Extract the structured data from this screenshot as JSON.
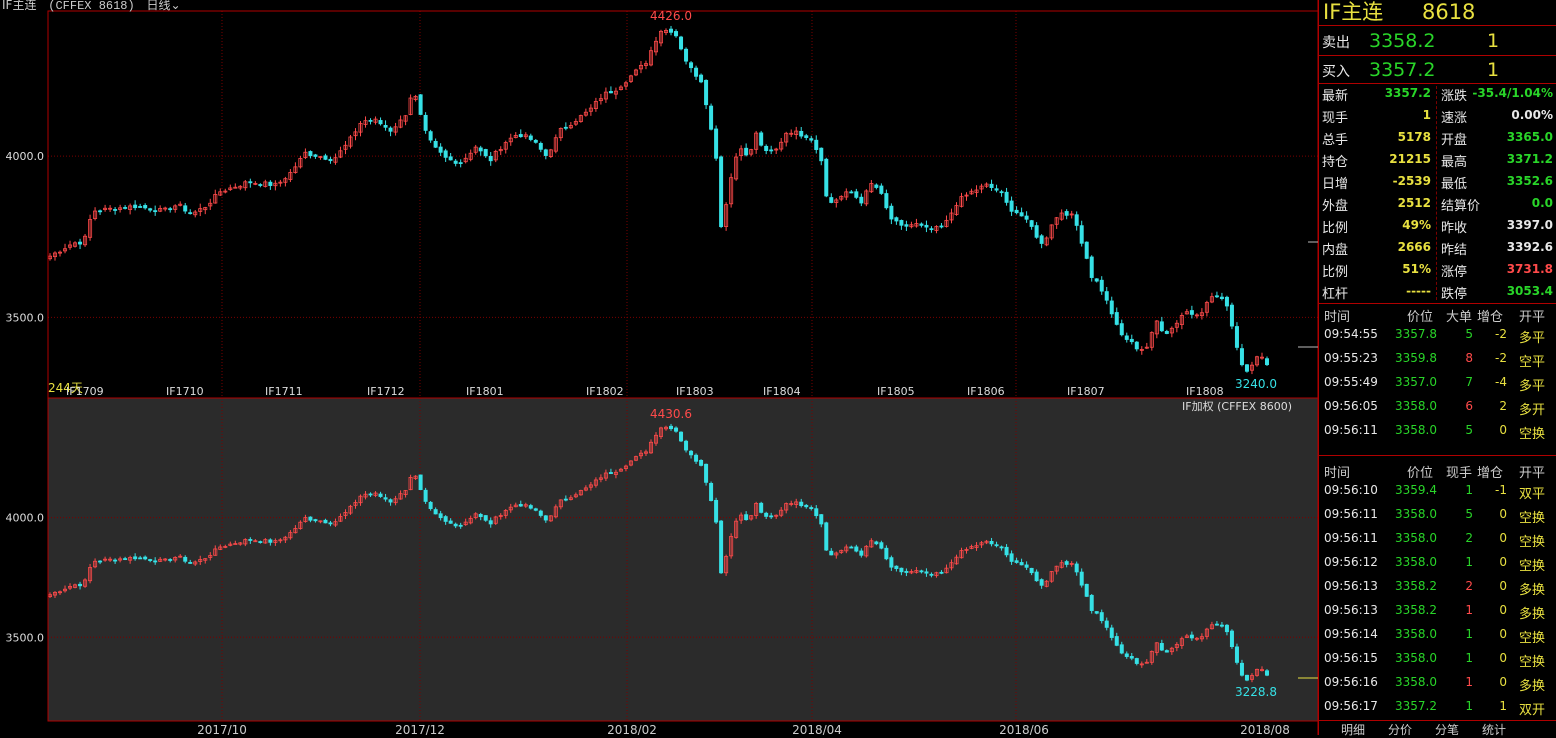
{
  "colors": {
    "up": "#ff4a4a",
    "down": "#36e1e6",
    "grid": "#7a0000",
    "frame": "#b00000",
    "upper_bg": "#000000",
    "lower_bg": "#2b2b2b",
    "yellow": "#e8e040",
    "green": "#29d529",
    "white": "#e8e8e8"
  },
  "header": {
    "instrument": "IF主连",
    "code_text": "(CFFEX 8618)",
    "period": "日线",
    "dropdown_icon": "chevron-down-icon"
  },
  "upper_panel": {
    "ticks": [
      "4000.0",
      "3500.0"
    ],
    "day_count": "244天",
    "high_label": "4426.0",
    "low_label": "3240.0",
    "contract_labels": [
      "IF1709",
      "IF1710",
      "IF1711",
      "IF1712",
      "IF1801",
      "IF1802",
      "IF1803",
      "IF1804",
      "IF1805",
      "IF1806",
      "IF1807",
      "IF1808"
    ]
  },
  "lower_panel": {
    "title": "IF加权 (CFFEX 8600)",
    "ticks": [
      "4000.0",
      "3500.0"
    ],
    "high_label": "4430.6",
    "low_label": "3228.8"
  },
  "x_axis": {
    "labels": [
      "2017/10",
      "2017/12",
      "2018/02",
      "2018/04",
      "2018/06",
      "2018/08"
    ]
  },
  "chart_data": [
    {
      "type": "candlestick",
      "title": "IF主连 (CFFEX 8618) 日线",
      "ylim": [
        3250,
        4450
      ],
      "y_ticks": [
        4000,
        3500
      ],
      "days": 244,
      "x_range": [
        "2017-07",
        "2018-08"
      ],
      "high": 4426.0,
      "low": 3240.0,
      "anchors": [
        [
          0,
          3690
        ],
        [
          8,
          3730
        ],
        [
          12,
          3735
        ],
        [
          15,
          3830
        ],
        [
          30,
          3845
        ],
        [
          40,
          3830
        ],
        [
          45,
          3850
        ],
        [
          50,
          3820
        ],
        [
          55,
          3845
        ],
        [
          60,
          3890
        ],
        [
          70,
          3920
        ],
        [
          80,
          3910
        ],
        [
          85,
          3950
        ],
        [
          90,
          4010
        ],
        [
          100,
          3990
        ],
        [
          105,
          4040
        ],
        [
          110,
          4110
        ],
        [
          115,
          4110
        ],
        [
          120,
          4080
        ],
        [
          125,
          4120
        ],
        [
          128,
          4210
        ],
        [
          132,
          4080
        ],
        [
          135,
          4030
        ],
        [
          140,
          3990
        ],
        [
          145,
          3980
        ],
        [
          150,
          4030
        ],
        [
          155,
          3985
        ],
        [
          160,
          4040
        ],
        [
          165,
          4070
        ],
        [
          170,
          4050
        ],
        [
          175,
          4000
        ],
        [
          180,
          4080
        ],
        [
          185,
          4110
        ],
        [
          190,
          4140
        ],
        [
          195,
          4190
        ],
        [
          200,
          4210
        ],
        [
          205,
          4250
        ],
        [
          210,
          4290
        ],
        [
          215,
          4390
        ],
        [
          220,
          4390
        ],
        [
          225,
          4280
        ],
        [
          230,
          4230
        ],
        [
          232,
          4130
        ],
        [
          235,
          3990
        ],
        [
          236,
          3760
        ],
        [
          238,
          3840
        ],
        [
          240,
          3930
        ],
        [
          243,
          4040
        ],
        [
          246,
          3990
        ],
        [
          249,
          4070
        ],
        [
          252,
          4010
        ],
        [
          256,
          4020
        ],
        [
          260,
          4080
        ],
        [
          264,
          4070
        ],
        [
          268,
          4060
        ],
        [
          272,
          3990
        ],
        [
          274,
          3850
        ],
        [
          278,
          3870
        ],
        [
          282,
          3890
        ],
        [
          286,
          3860
        ],
        [
          290,
          3920
        ],
        [
          293,
          3880
        ],
        [
          296,
          3810
        ],
        [
          300,
          3780
        ],
        [
          305,
          3790
        ],
        [
          310,
          3770
        ],
        [
          315,
          3780
        ],
        [
          320,
          3860
        ],
        [
          325,
          3890
        ],
        [
          330,
          3910
        ],
        [
          335,
          3890
        ],
        [
          338,
          3840
        ],
        [
          342,
          3820
        ],
        [
          346,
          3780
        ],
        [
          350,
          3720
        ],
        [
          353,
          3790
        ],
        [
          357,
          3830
        ],
        [
          361,
          3810
        ],
        [
          365,
          3700
        ],
        [
          367,
          3630
        ],
        [
          370,
          3600
        ],
        [
          374,
          3520
        ],
        [
          377,
          3450
        ],
        [
          380,
          3430
        ],
        [
          384,
          3400
        ],
        [
          387,
          3410
        ],
        [
          390,
          3490
        ],
        [
          393,
          3450
        ],
        [
          396,
          3470
        ],
        [
          400,
          3520
        ],
        [
          403,
          3510
        ],
        [
          406,
          3520
        ],
        [
          410,
          3570
        ],
        [
          412,
          3560
        ],
        [
          415,
          3540
        ],
        [
          417,
          3460
        ],
        [
          419,
          3390
        ],
        [
          421,
          3330
        ],
        [
          424,
          3360
        ],
        [
          426,
          3380
        ],
        [
          429,
          3360
        ]
      ]
    },
    {
      "type": "candlestick",
      "title": "IF加权 (CFFEX 8600)",
      "ylim": [
        3150,
        4500
      ],
      "y_ticks": [
        4000,
        3500
      ],
      "high": 4430.6,
      "low": 3228.8
    }
  ],
  "sidebar": {
    "title": "IF主连",
    "code": "8618",
    "sell": {
      "label": "卖出",
      "price": "3358.2",
      "qty": "1"
    },
    "buy": {
      "label": "买入",
      "price": "3357.2",
      "qty": "1"
    },
    "quote_rows": [
      {
        "l1": "最新",
        "v1": "3357.2",
        "c1": "green",
        "l2": "涨跌",
        "v2": "-35.4/1.04%",
        "c2": "green"
      },
      {
        "l1": "现手",
        "v1": "1",
        "c1": "yellow",
        "l2": "速涨",
        "v2": "0.00%",
        "c2": "white"
      },
      {
        "l1": "总手",
        "v1": "5178",
        "c1": "yellow",
        "l2": "开盘",
        "v2": "3365.0",
        "c2": "green"
      },
      {
        "l1": "持仓",
        "v1": "21215",
        "c1": "yellow",
        "l2": "最高",
        "v2": "3371.2",
        "c2": "green"
      },
      {
        "l1": "日增",
        "v1": "-2539",
        "c1": "yellow",
        "l2": "最低",
        "v2": "3352.6",
        "c2": "green"
      },
      {
        "l1": "外盘",
        "v1": "2512",
        "c1": "yellow",
        "l2": "结算价",
        "v2": "0.0",
        "c2": "green"
      },
      {
        "l1": "比例",
        "v1": "49%",
        "c1": "yellow",
        "l2": "昨收",
        "v2": "3397.0",
        "c2": "white"
      },
      {
        "l1": "内盘",
        "v1": "2666",
        "c1": "yellow",
        "l2": "昨结",
        "v2": "3392.6",
        "c2": "white"
      },
      {
        "l1": "比例",
        "v1": "51%",
        "c1": "yellow",
        "l2": "涨停",
        "v2": "3731.8",
        "c2": "up"
      },
      {
        "l1": "杠杆",
        "v1": "-----",
        "c1": "yellow",
        "l2": "跌停",
        "v2": "3053.4",
        "c2": "green"
      }
    ],
    "trades1_header": [
      "时间",
      "价位",
      "大单",
      "增仓",
      "开平"
    ],
    "trades1": [
      {
        "time": "09:54:55",
        "price": "3357.8",
        "size": "5",
        "size_c": "green",
        "chg": "-2",
        "type": "多平"
      },
      {
        "time": "09:55:23",
        "price": "3359.8",
        "size": "8",
        "size_c": "up",
        "chg": "-2",
        "type": "空平"
      },
      {
        "time": "09:55:49",
        "price": "3357.0",
        "size": "7",
        "size_c": "green",
        "chg": "-4",
        "type": "多平"
      },
      {
        "time": "09:56:05",
        "price": "3358.0",
        "size": "6",
        "size_c": "up",
        "chg": "2",
        "type": "多开"
      },
      {
        "time": "09:56:11",
        "price": "3358.0",
        "size": "5",
        "size_c": "green",
        "chg": "0",
        "type": "空换"
      }
    ],
    "trades2_header": [
      "时间",
      "价位",
      "现手",
      "增仓",
      "开平"
    ],
    "trades2": [
      {
        "time": "09:56:10",
        "price": "3359.4",
        "size": "1",
        "size_c": "green",
        "chg": "-1",
        "type": "双平"
      },
      {
        "time": "09:56:11",
        "price": "3358.0",
        "size": "5",
        "size_c": "green",
        "chg": "0",
        "type": "空换"
      },
      {
        "time": "09:56:11",
        "price": "3358.0",
        "size": "2",
        "size_c": "green",
        "chg": "0",
        "type": "空换"
      },
      {
        "time": "09:56:12",
        "price": "3358.0",
        "size": "1",
        "size_c": "green",
        "chg": "0",
        "type": "空换"
      },
      {
        "time": "09:56:13",
        "price": "3358.2",
        "size": "2",
        "size_c": "up",
        "chg": "0",
        "type": "多换"
      },
      {
        "time": "09:56:13",
        "price": "3358.2",
        "size": "1",
        "size_c": "up",
        "chg": "0",
        "type": "多换"
      },
      {
        "time": "09:56:14",
        "price": "3358.0",
        "size": "1",
        "size_c": "green",
        "chg": "0",
        "type": "空换"
      },
      {
        "time": "09:56:15",
        "price": "3358.0",
        "size": "1",
        "size_c": "green",
        "chg": "0",
        "type": "空换"
      },
      {
        "time": "09:56:16",
        "price": "3358.0",
        "size": "1",
        "size_c": "up",
        "chg": "0",
        "type": "多换"
      },
      {
        "time": "09:56:17",
        "price": "3357.2",
        "size": "1",
        "size_c": "green",
        "chg": "1",
        "type": "双开"
      }
    ],
    "tabs": [
      "明细",
      "分价",
      "分笔",
      "统计"
    ]
  }
}
